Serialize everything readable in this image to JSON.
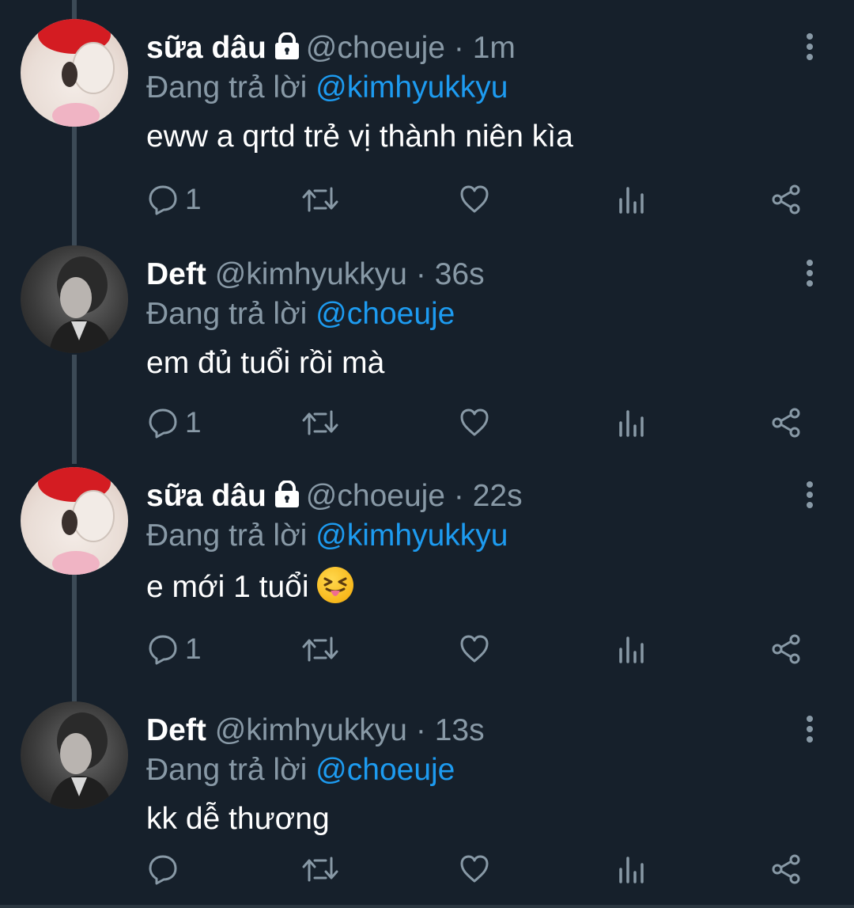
{
  "tweets": [
    {
      "name": "sữa dâu",
      "protected": true,
      "handle": "@choeuje",
      "separator": "·",
      "time": "1m",
      "reply_prefix": "Đang trả lời",
      "reply_to": "@kimhyukkyu",
      "text": "eww a qrtd trẻ vị thành niên kìa",
      "reply_count": "1",
      "avatar": "kitty-plush-avatar"
    },
    {
      "name": "Deft",
      "protected": false,
      "handle": "@kimhyukkyu",
      "separator": "·",
      "time": "36s",
      "reply_prefix": "Đang trả lời",
      "reply_to": "@choeuje",
      "text": "em đủ tuổi rồi mà",
      "reply_count": "1",
      "avatar": "person-photo-avatar"
    },
    {
      "name": "sữa dâu",
      "protected": true,
      "handle": "@choeuje",
      "separator": "·",
      "time": "22s",
      "reply_prefix": "Đang trả lời",
      "reply_to": "@kimhyukkyu",
      "text": "e mới 1 tuổi",
      "emoji": "squinting-face-with-tongue",
      "reply_count": "1",
      "avatar": "kitty-plush-avatar"
    },
    {
      "name": "Deft",
      "protected": false,
      "handle": "@kimhyukkyu",
      "separator": "·",
      "time": "13s",
      "reply_prefix": "Đang trả lời",
      "reply_to": "@choeuje",
      "text": "kk dễ thương",
      "reply_count": "",
      "avatar": "person-photo-avatar"
    }
  ],
  "colors": {
    "background": "#16202b",
    "text": "#ffffff",
    "secondary": "#8899a6",
    "mention": "#1d9bf0",
    "thread_line": "#3c4a56"
  },
  "icons": [
    "reply-icon",
    "retweet-icon",
    "like-icon",
    "analytics-icon",
    "share-icon",
    "more-icon",
    "lock-icon"
  ]
}
